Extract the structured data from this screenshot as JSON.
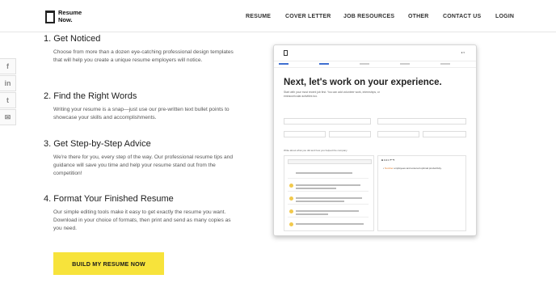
{
  "brand": {
    "line1": "Resume",
    "line2": "Now."
  },
  "nav": [
    {
      "label": "RESUME"
    },
    {
      "label": "COVER LETTER"
    },
    {
      "label": "JOB RESOURCES"
    },
    {
      "label": "OTHER"
    },
    {
      "label": "CONTACT US"
    },
    {
      "label": "LOGIN"
    }
  ],
  "social": [
    "f",
    "in",
    "t",
    "✉"
  ],
  "features": [
    {
      "title": "1. Get Noticed",
      "text": "Choose from more than a dozen eye-catching professional design templates that will help you create a unique resume employers will notice."
    },
    {
      "title": "2. Find the Right Words",
      "text": "Writing your resume is a snap—just use our pre-written text bullet points to showcase your skills and accomplishments."
    },
    {
      "title": "3. Get Step-by-Step Advice",
      "text": "We're there for you, every step of the way. Our professional resume tips and guidance will save you time and help your resume stand out from the competition!"
    },
    {
      "title": "4. Format Your Finished Resume",
      "text": "Our simple editing tools make it easy to get exactly the resume you want. Download in your choice of formats, then print and send as many copies as you need."
    }
  ],
  "cta": {
    "label": "BUILD MY RESUME NOW"
  },
  "preview": {
    "title": "Next, let's work on your experience.",
    "subtitle": "Start with your most recent job first. You can add volunteer work, internships, or extracurricular activities too.",
    "prompt": "Write about what you did and how you helped the company",
    "bullet_keyword": "Number",
    "bullet_text": "employees and ensured optimal productivity."
  }
}
